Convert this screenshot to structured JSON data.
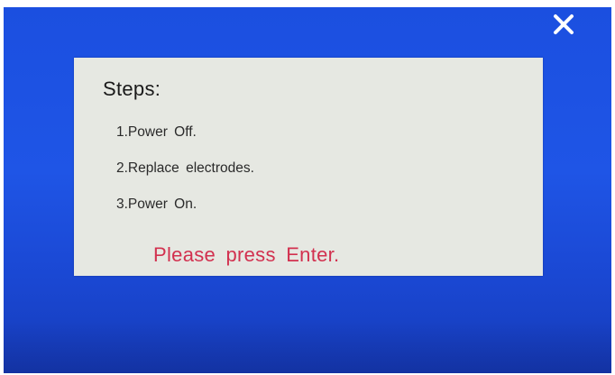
{
  "dialog": {
    "title": "Steps:",
    "steps": [
      "1.Power  Off.",
      "2.Replace  electrodes.",
      "3.Power  On."
    ],
    "prompt": "Please  press  Enter."
  },
  "colors": {
    "screen_background": "#1f55e6",
    "dialog_background": "#e6e8e2",
    "prompt_text": "#d2314f",
    "close_icon": "#ffffff"
  },
  "icons": {
    "close": "close-icon"
  }
}
